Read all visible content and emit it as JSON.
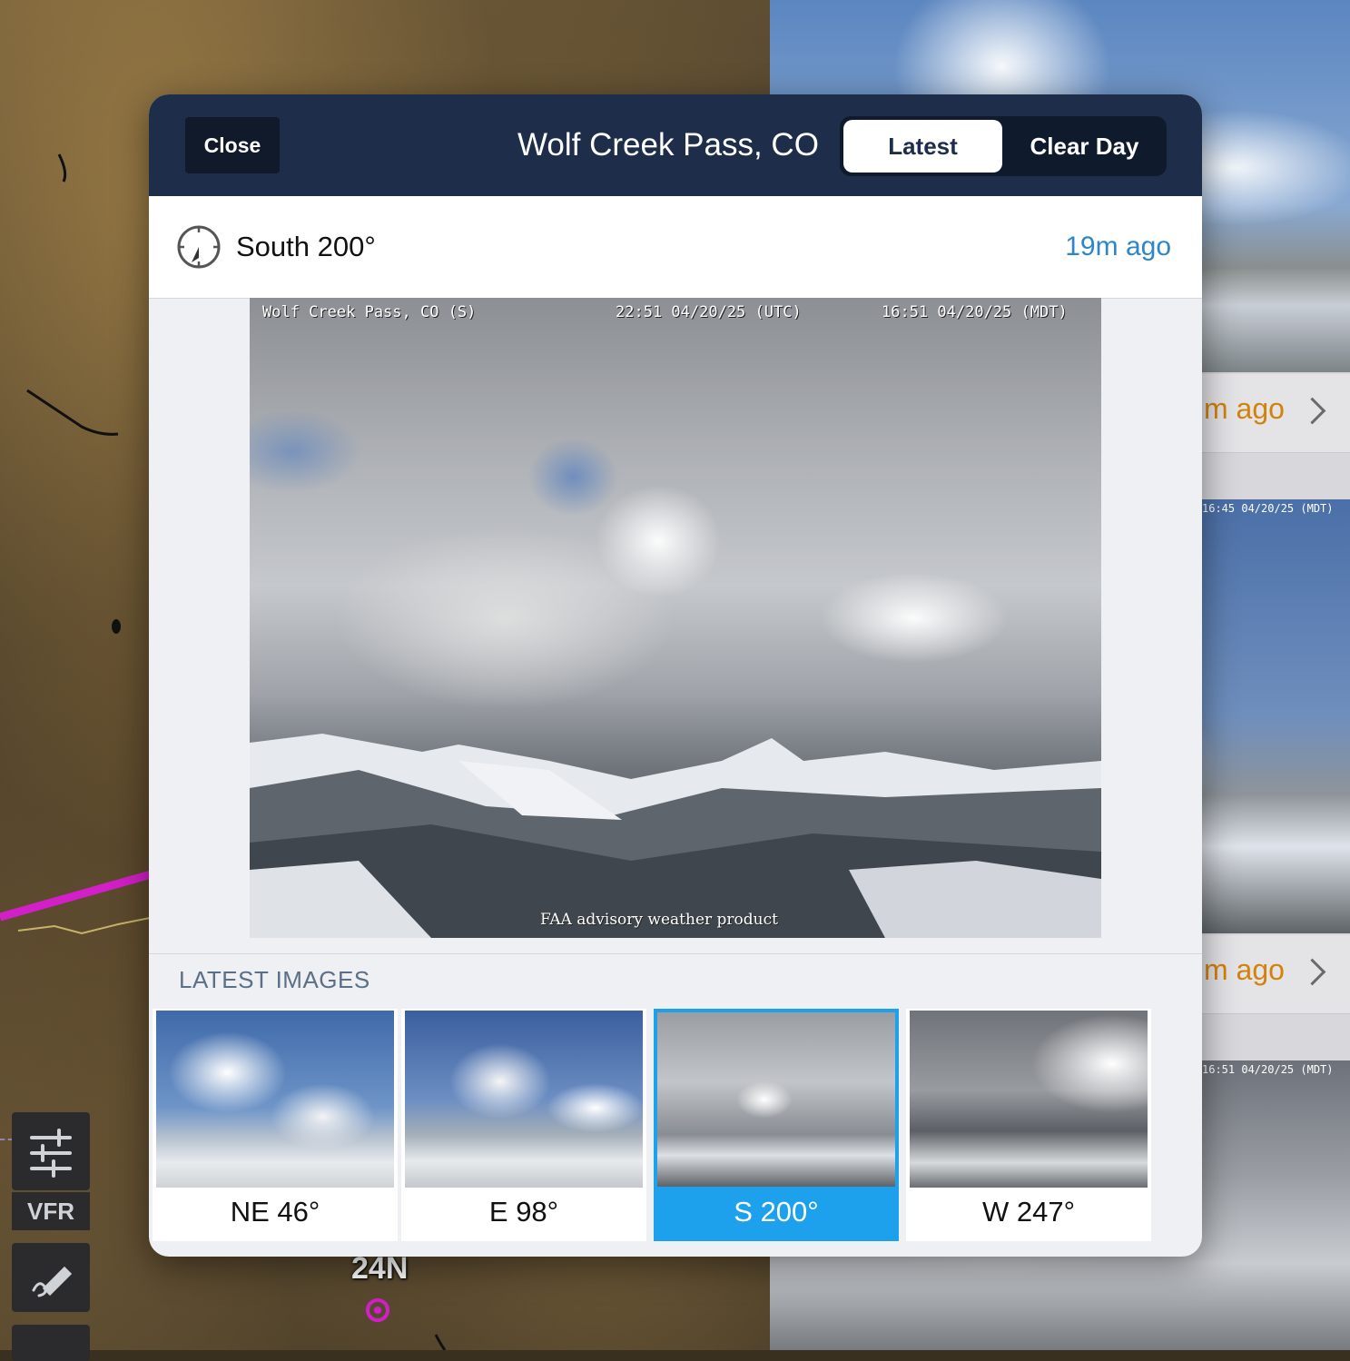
{
  "header": {
    "close_label": "Close",
    "title": "Wolf Creek Pass, CO",
    "segments": [
      "Latest",
      "Clear Day"
    ],
    "active_segment": "Latest"
  },
  "direction_bar": {
    "direction": "South 200°",
    "age": "19m ago"
  },
  "camera": {
    "overlay_station": "Wolf Creek Pass, CO (S)",
    "overlay_utc": "22:51 04/20/25 (UTC)",
    "overlay_local": "16:51 04/20/25 (MDT)",
    "footer": "FAA advisory weather product"
  },
  "latest_images": {
    "heading": "LATEST IMAGES",
    "items": [
      {
        "label": "NE 46°",
        "selected": false
      },
      {
        "label": "E 98°",
        "selected": false
      },
      {
        "label": "S 200°",
        "selected": true
      },
      {
        "label": "W 247°",
        "selected": false
      }
    ]
  },
  "background_list": {
    "row1_age": "m ago",
    "row2_age": "m ago",
    "ts1": "16:45 04/20/25 (MDT)",
    "ts2": "16:51 04/20/25 (MDT)"
  },
  "toolbar": {
    "vfr_label": "VFR"
  },
  "map": {
    "airport_label": "24N"
  },
  "colors": {
    "header_bg": "#1e2e4a",
    "accent_blue": "#1da1ed",
    "age_blue": "#2d86c9",
    "route_magenta": "#d21fc8",
    "bg_orange": "#d3820c"
  }
}
